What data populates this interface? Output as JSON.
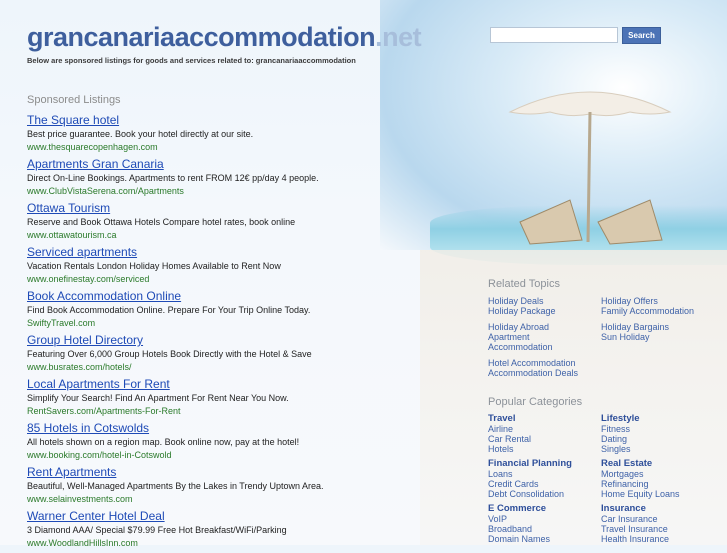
{
  "header": {
    "domain_main": "grancanariaaccommodation",
    "domain_tld": ".net",
    "tagline": "Below are sponsored listings for goods and services related to: grancanariaaccommodation"
  },
  "search": {
    "value": "",
    "button_label": "Search"
  },
  "sponsored": {
    "heading": "Sponsored Listings",
    "listings": [
      {
        "title": "The Square hotel",
        "description": "Best price guarantee. Book your hotel directly at our site.",
        "url": "www.thesquarecopenhagen.com"
      },
      {
        "title": "Apartments Gran Canaria",
        "description": "Direct On-Line Bookings. Apartments to rent FROM 12€ pp/day 4 people.",
        "url": "www.ClubVistaSerena.com/Apartments"
      },
      {
        "title": "Ottawa Tourism",
        "description": "Reserve and Book Ottawa Hotels Compare hotel rates, book online",
        "url": "www.ottawatourism.ca"
      },
      {
        "title": "Serviced apartments",
        "description": "Vacation Rentals London Holiday Homes Available to Rent Now",
        "url": "www.onefinestay.com/serviced"
      },
      {
        "title": "Book Accommodation Online",
        "description": "Find Book Accommodation Online. Prepare For Your Trip Online Today.",
        "url": "SwiftyTravel.com"
      },
      {
        "title": "Group Hotel Directory",
        "description": "Featuring Over 6,000 Group Hotels Book Directly with the Hotel & Save",
        "url": "www.busrates.com/hotels/"
      },
      {
        "title": "Local Apartments For Rent",
        "description": "Simplify Your Search! Find An Apartment For Rent Near You Now.",
        "url": "RentSavers.com/Apartments-For-Rent"
      },
      {
        "title": "85 Hotels in Cotswolds",
        "description": "All hotels shown on a region map. Book online now, pay at the hotel!",
        "url": "www.booking.com/hotel-in-Cotswold"
      },
      {
        "title": "Rent Apartments",
        "description": "Beautiful, Well-Managed Apartments By the Lakes in Trendy Uptown Area.",
        "url": "www.selainvestments.com"
      },
      {
        "title": "Warner Center Hotel Deal",
        "description": "3 Diamond AAA/ Special $79.99 Free Hot Breakfast/WiFi/Parking",
        "url": "www.WoodlandHillsInn.com"
      }
    ]
  },
  "related": {
    "heading": "Related Topics",
    "left": [
      "Holiday Deals",
      "Holiday Package",
      "Holiday Abroad",
      "Apartment",
      "Accommodation",
      "Hotel Accommodation",
      "Accommodation Deals"
    ],
    "right": [
      "Holiday Offers",
      "Family Accommodation",
      "Holiday Bargains",
      "Sun Holiday"
    ]
  },
  "popular": {
    "heading": "Popular Categories",
    "left": [
      {
        "name": "Travel",
        "items": [
          "Airline",
          "Car Rental",
          "Hotels"
        ]
      },
      {
        "name": "Financial Planning",
        "items": [
          "Loans",
          "Credit Cards",
          "Debt Consolidation"
        ]
      },
      {
        "name": "E Commerce",
        "items": [
          "VoIP",
          "Broadband",
          "Domain Names"
        ]
      }
    ],
    "right": [
      {
        "name": "Lifestyle",
        "items": [
          "Fitness",
          "Dating",
          "Singles"
        ]
      },
      {
        "name": "Real Estate",
        "items": [
          "Mortgages",
          "Refinancing",
          "Home Equity Loans"
        ]
      },
      {
        "name": "Insurance",
        "items": [
          "Car Insurance",
          "Travel Insurance",
          "Health Insurance"
        ]
      }
    ]
  }
}
